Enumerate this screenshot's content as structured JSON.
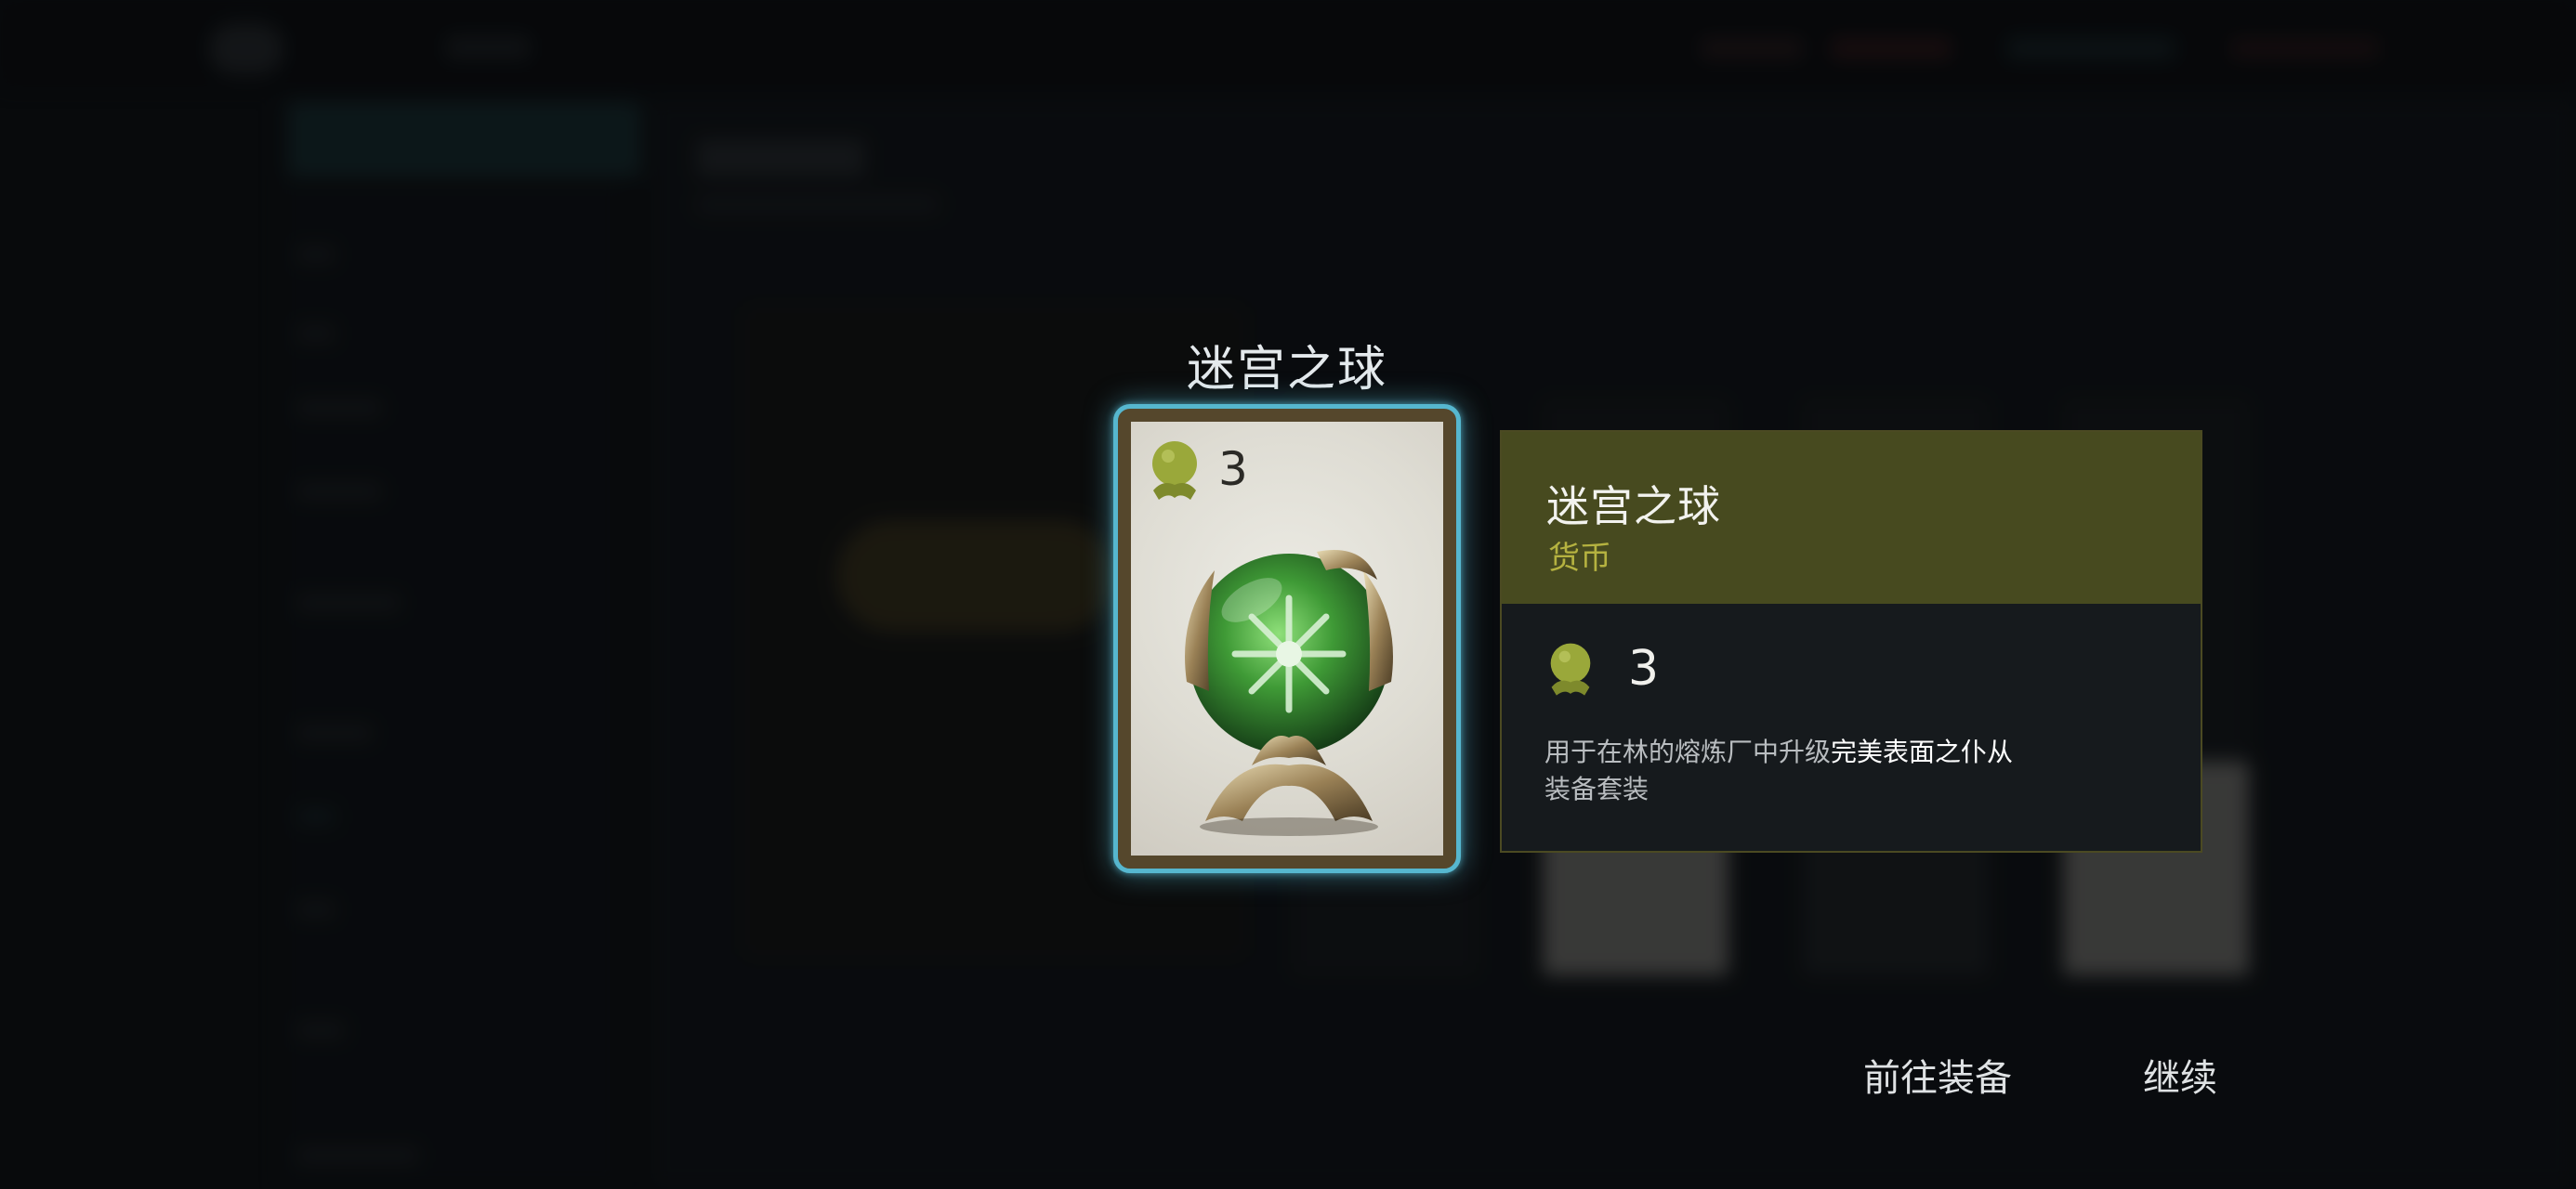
{
  "item": {
    "title": "迷宫之球",
    "count": "3",
    "name": "迷宫之球",
    "type": "货币",
    "description_prefix": "用于在林的熔炼厂中升级",
    "description_highlight": "完美表面之仆从",
    "description_suffix": "装备套装"
  },
  "icons": {
    "currency": "labyrinth-orb-currency-icon",
    "item_art": "labyrinth-orb-image"
  },
  "colors": {
    "card_border": "#56b7cf",
    "header_bg": "#474a1f",
    "type_text": "#b5b240",
    "currency_icon": "#9aa83a"
  },
  "buttons": {
    "go_to_equipment": "前往装备",
    "continue": "继续"
  }
}
